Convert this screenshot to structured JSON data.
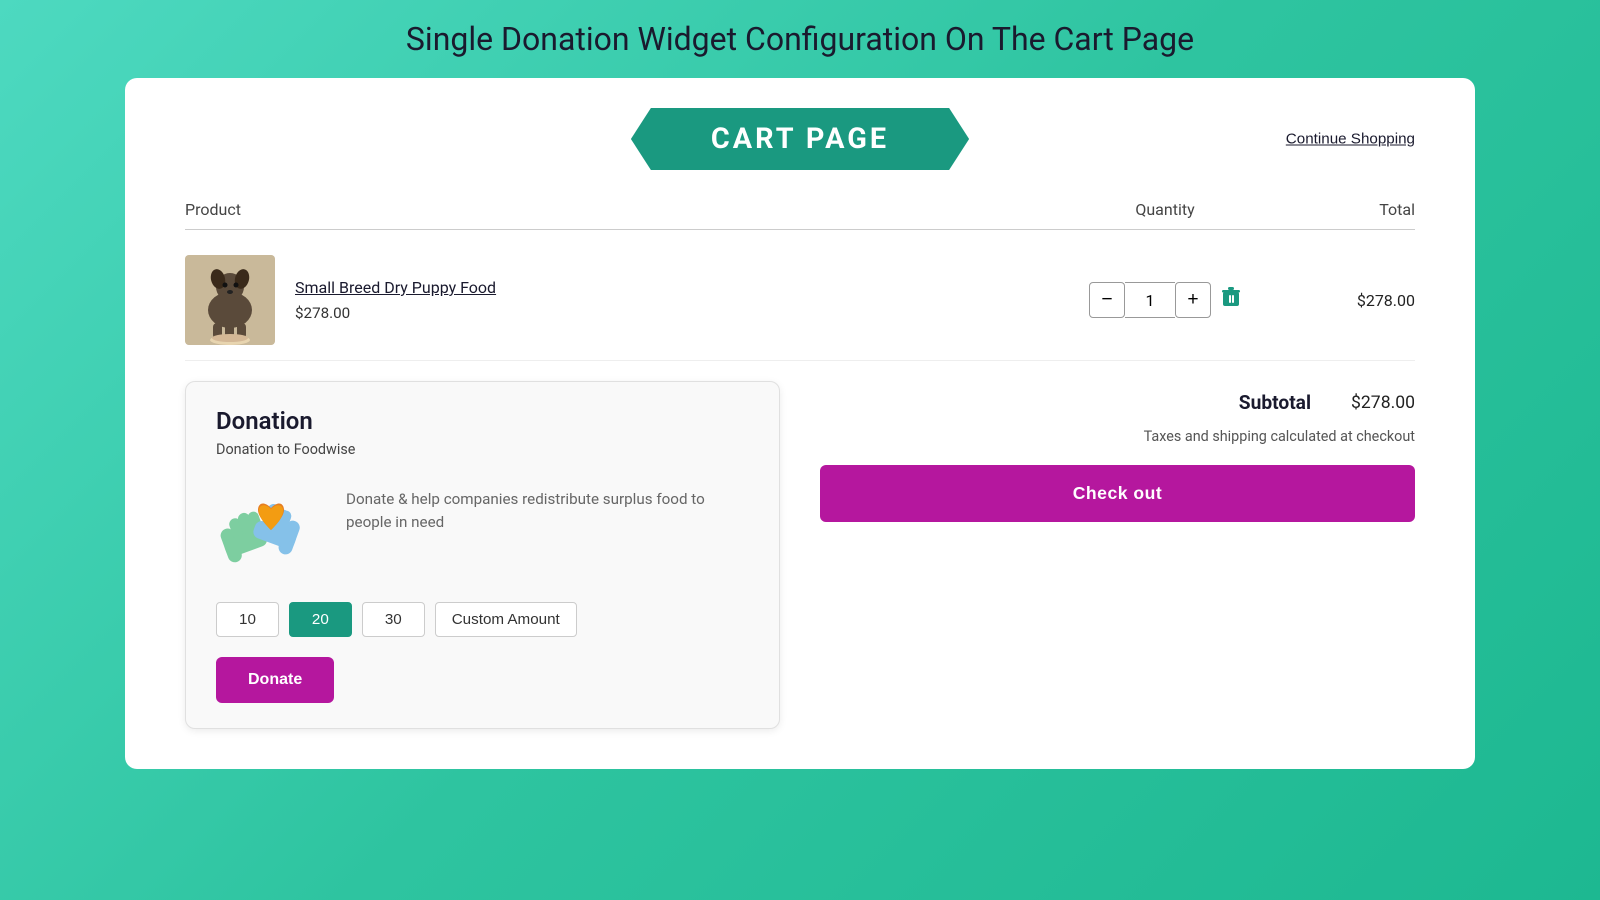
{
  "page": {
    "title": "Single Donation Widget Configuration On The Cart Page"
  },
  "cart": {
    "banner": "CART PAGE",
    "continue_shopping": "Continue Shopping",
    "columns": {
      "product": "Product",
      "quantity": "Quantity",
      "total": "Total"
    },
    "product": {
      "name": "Small Breed Dry Puppy Food",
      "price": "$278.00",
      "quantity": 1,
      "total": "$278.00"
    },
    "subtotal_label": "Subtotal",
    "subtotal_value": "$278.00",
    "tax_note": "Taxes and shipping calculated at checkout",
    "checkout_label": "Check out"
  },
  "donation": {
    "title": "Donation",
    "subtitle": "Donation to Foodwise",
    "description": "Donate & help companies redistribute surplus food to people in need",
    "amounts": [
      "10",
      "20",
      "30"
    ],
    "active_amount": "20",
    "custom_label": "Custom Amount",
    "donate_label": "Donate"
  },
  "icons": {
    "minus": "−",
    "plus": "+",
    "delete": "🗑"
  }
}
